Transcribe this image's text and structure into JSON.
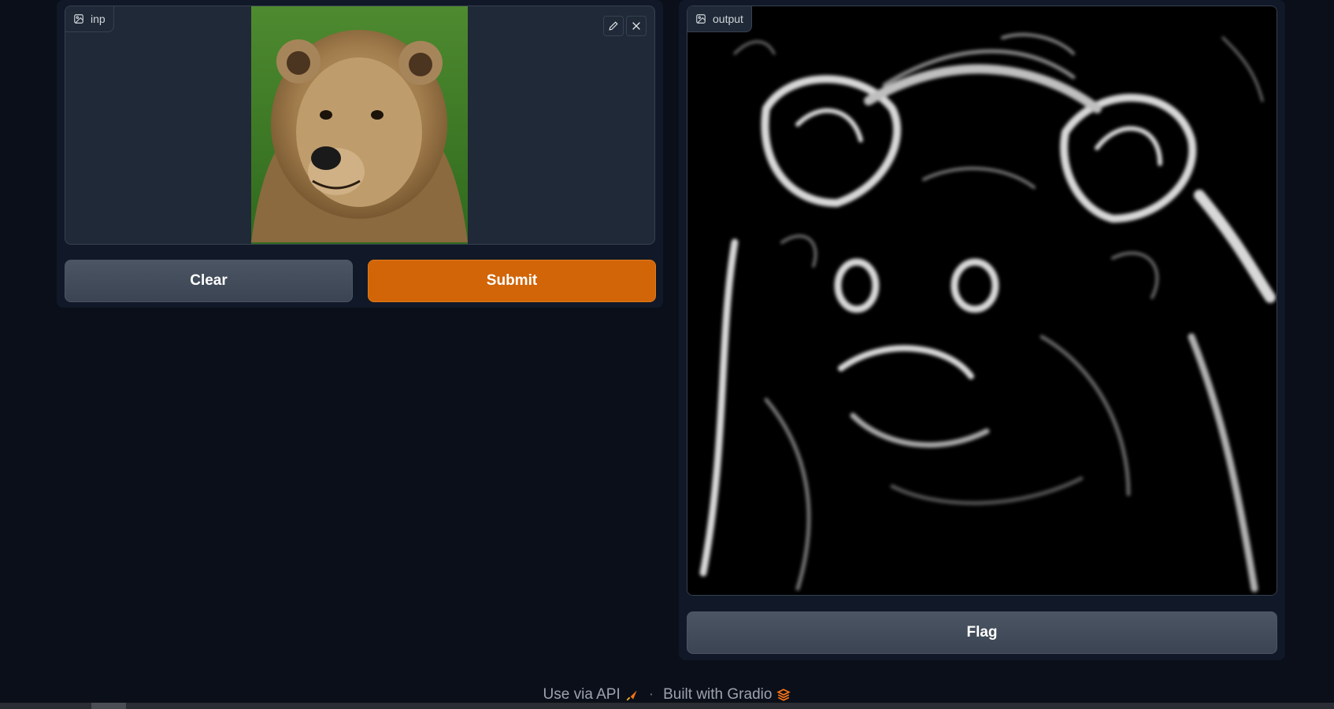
{
  "input": {
    "label": "inp",
    "image_alt": "Brown bear"
  },
  "output": {
    "label": "output",
    "image_alt": "Edge-detected bear"
  },
  "buttons": {
    "clear": "Clear",
    "submit": "Submit",
    "flag": "Flag"
  },
  "footer": {
    "api": "Use via API",
    "separator": "·",
    "built": "Built with Gradio"
  },
  "colors": {
    "background": "#0b0f19",
    "panel": "#111827",
    "primary": "#d16507",
    "secondary": "#4b5563"
  },
  "icons": {
    "image": "image-icon",
    "edit": "pencil-icon",
    "close": "close-icon",
    "api": "rocket-icon",
    "gradio": "gradio-logo-icon"
  }
}
